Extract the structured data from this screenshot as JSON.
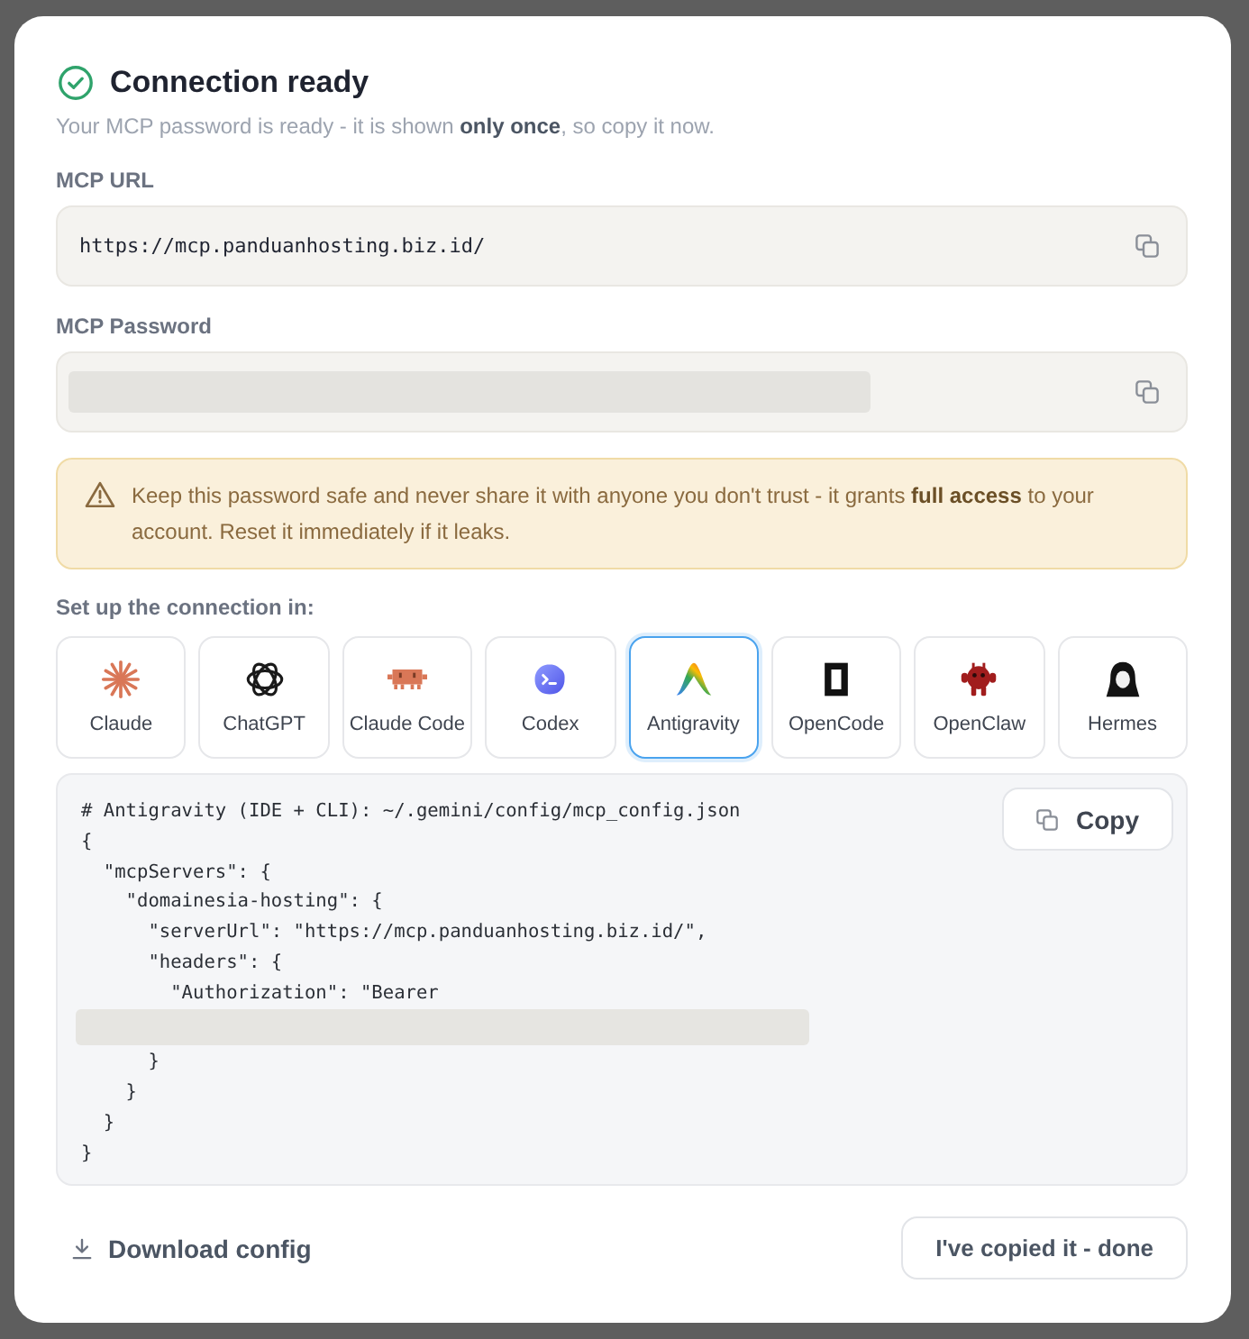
{
  "dialog": {
    "title": "Connection ready",
    "subtitle": "Your MCP password is ready - it is shown **only once**, so copy it now."
  },
  "fields": [
    {
      "label": "MCP URL",
      "value": "https://mcp.panduanhosting.biz.id/",
      "redacted": false
    },
    {
      "label": "MCP Password",
      "redacted": true
    }
  ],
  "warning": {
    "text": "Keep this password safe and never share it with anyone you don't trust - it grants **full access** to your account. Reset it immediately if it leaks."
  },
  "setup": {
    "label": "Set up the connection in:",
    "clients": [
      {
        "label": "Claude",
        "selected": false
      },
      {
        "label": "ChatGPT",
        "selected": false
      },
      {
        "label": "Claude Code",
        "selected": false
      },
      {
        "label": "Codex",
        "selected": false
      },
      {
        "label": "Antigravity",
        "selected": true
      },
      {
        "label": "OpenCode",
        "selected": false
      },
      {
        "label": "OpenClaw",
        "selected": false
      },
      {
        "label": "Hermes",
        "selected": false
      }
    ]
  },
  "code": {
    "copy_button": "Copy",
    "lines": [
      {
        "kind": "text",
        "text": "# Antigravity (IDE + CLI): ~/.gemini/config/mcp_config.json"
      },
      {
        "kind": "text",
        "text": "{"
      },
      {
        "kind": "text",
        "text": "  \"mcpServers\": {"
      },
      {
        "kind": "text",
        "text": "    \"domainesia-hosting\": {"
      },
      {
        "kind": "text",
        "text": "      \"serverUrl\": \"https://mcp.panduanhosting.biz.id/\","
      },
      {
        "kind": "text",
        "text": "      \"headers\": {"
      },
      {
        "kind": "text",
        "text": "        \"Authorization\": \"Bearer"
      },
      {
        "kind": "redacted"
      },
      {
        "kind": "text",
        "text": "      }"
      },
      {
        "kind": "text",
        "text": "    }"
      },
      {
        "kind": "text",
        "text": "  }"
      },
      {
        "kind": "text",
        "text": "}"
      }
    ]
  },
  "footer": {
    "download_link": "Download config",
    "done_button": "I've copied it - done"
  }
}
